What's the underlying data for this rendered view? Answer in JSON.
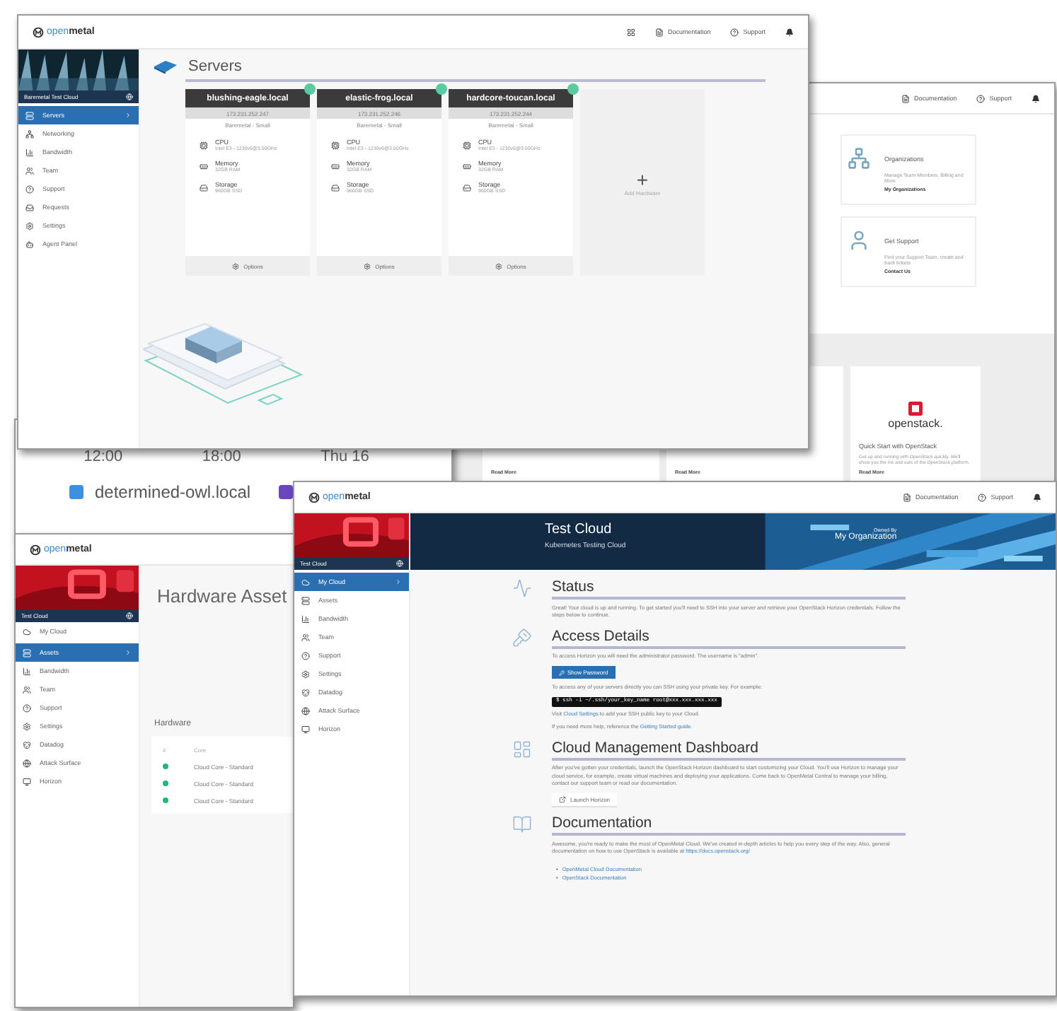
{
  "windows": [
    {
      "kind": "dashboard",
      "header": {
        "links": [
          "Documentation",
          "Support"
        ]
      },
      "cards": [
        {
          "title": "Organizations",
          "text": "Manage Team Members, Billing and More",
          "action": "My Organizations"
        },
        {
          "title": "Get Support",
          "text": "Find your Support Team, create and track tickets",
          "action": "Contact Us"
        }
      ],
      "quickstarts": [
        {
          "action": "Read More"
        },
        {
          "action": "Read More"
        },
        {
          "logo": "openstack.",
          "title": "Quick Start with OpenStack",
          "text": "Get up and running with OpenStack quickly. We'll show you the ins and outs of the OpenStack platform.",
          "action": "Read More"
        }
      ]
    },
    {
      "kind": "chart",
      "ticks": [
        "12:00",
        "18:00",
        "Thu 16"
      ],
      "legend": [
        {
          "label": "determined-owl.local",
          "color": "#3d8fe0"
        },
        {
          "color": "#6b46c1"
        }
      ]
    },
    {
      "kind": "servers",
      "logo": "open**metal**",
      "header": {
        "links": [
          "Documentation",
          "Support"
        ]
      },
      "sidebar": {
        "title": "Baremetal Test Cloud",
        "items": [
          {
            "label": "Servers",
            "selected": true
          },
          {
            "label": "Networking",
            "selected": false
          },
          {
            "label": "Bandwidth",
            "selected": false
          },
          {
            "label": "Team",
            "selected": false
          },
          {
            "label": "Support",
            "selected": false
          },
          {
            "label": "Requests",
            "selected": false
          },
          {
            "label": "Settings",
            "selected": false
          },
          {
            "label": "Agent Panel",
            "selected": false
          }
        ]
      },
      "title": "Servers",
      "servers": [
        {
          "name": "blushing-eagle.local",
          "ip": "173.231.252.247",
          "plan": "Baremetal - Small",
          "online": true,
          "specs": [
            {
              "label": "CPU",
              "value": "Intel E3 - 1230v6@3.50GHz"
            },
            {
              "label": "Memory",
              "value": "32GB RAM"
            },
            {
              "label": "Storage",
              "value": "960GB SSD"
            }
          ],
          "action": "Options"
        },
        {
          "name": "elastic-frog.local",
          "ip": "173.231.252.246",
          "plan": "Baremetal - Small",
          "online": true,
          "specs": [
            {
              "label": "CPU",
              "value": "Intel E3 - 1230v6@3.50GHz"
            },
            {
              "label": "Memory",
              "value": "32GB RAM"
            },
            {
              "label": "Storage",
              "value": "960GB SSD"
            }
          ],
          "action": "Options"
        },
        {
          "name": "hardcore-toucan.local",
          "ip": "173.231.252.244",
          "plan": "Baremetal - Small",
          "online": true,
          "specs": [
            {
              "label": "CPU",
              "value": "Intel E3 - 1230v6@3.50GHz"
            },
            {
              "label": "Memory",
              "value": "32GB RAM"
            },
            {
              "label": "Storage",
              "value": "960GB SSD"
            }
          ],
          "action": "Options"
        }
      ],
      "add": {
        "icon": "+",
        "label": "Add Hardware"
      }
    },
    {
      "kind": "assets",
      "logo": "open**metal**",
      "sidebar": {
        "title": "Test Cloud",
        "items": [
          {
            "label": "My Cloud",
            "selected": false
          },
          {
            "label": "Assets",
            "selected": true
          },
          {
            "label": "Bandwidth",
            "selected": false
          },
          {
            "label": "Team",
            "selected": false
          },
          {
            "label": "Support",
            "selected": false
          },
          {
            "label": "Settings",
            "selected": false
          },
          {
            "label": "Datadog",
            "selected": false
          },
          {
            "label": "Attack Surface",
            "selected": false
          },
          {
            "label": "Horizon",
            "selected": false
          }
        ]
      },
      "title": "Hardware Asset",
      "section": "Hardware",
      "columns": [
        "#",
        "Core"
      ],
      "rows": [
        {
          "color": "#1fb77a",
          "name": "Cloud Core - Standard"
        },
        {
          "color": "#1fb77a",
          "name": "Cloud Core - Standard"
        },
        {
          "color": "#1fb77a",
          "name": "Cloud Core - Standard"
        }
      ]
    },
    {
      "kind": "cloud",
      "logo": "open**metal**",
      "header": {
        "links": [
          "Documentation",
          "Support"
        ]
      },
      "sidebar": {
        "title": "Test Cloud",
        "items": [
          {
            "label": "My Cloud",
            "selected": true
          },
          {
            "label": "Assets",
            "selected": false
          },
          {
            "label": "Bandwidth",
            "selected": false
          },
          {
            "label": "Team",
            "selected": false
          },
          {
            "label": "Support",
            "selected": false
          },
          {
            "label": "Settings",
            "selected": false
          },
          {
            "label": "Datadog",
            "selected": false
          },
          {
            "label": "Attack Surface",
            "selected": false
          },
          {
            "label": "Horizon",
            "selected": false
          }
        ]
      },
      "banner": {
        "title": "Test Cloud",
        "subtitle": "Kubernetes Testing Cloud",
        "owner_label": "Owned By",
        "owner": "My Organization"
      },
      "sections": [
        {
          "kind": "status",
          "heading": "Status",
          "blocks": [
            {
              "kind": "text",
              "text": "Great! Your cloud is up and running. To get started you'll need to SSH into your server and retrieve your OpenStack Horizon credentials. Follow the steps below to continue."
            }
          ]
        },
        {
          "kind": "access",
          "heading": "Access Details",
          "blocks": [
            {
              "kind": "text",
              "text": "To access Horizon you will need the administrator password. The username is \"admin\"."
            },
            {
              "kind": "button",
              "text": "Show Password"
            },
            {
              "kind": "text",
              "text": "To access any of your servers directly you can SSH using your private key. For example:"
            },
            {
              "kind": "code",
              "text": "$ ssh -i ~/.ssh/your_key_name root@xxx.xxx.xxx.xxx"
            },
            {
              "kind": "linktext",
              "before": "Visit ",
              "link": "Cloud Settings",
              "after": " to add your SSH public key to your Cloud."
            },
            {
              "kind": "linktext",
              "before": "If you need more help, reference the ",
              "link": "Getting Started guide",
              "after": "."
            }
          ]
        },
        {
          "kind": "dashboard",
          "heading": "Cloud Management Dashboard",
          "blocks": [
            {
              "kind": "text",
              "text": "After you've gotten your credentials, launch the OpenStack Horizon dashboard to start customizing your Cloud. You'll use Horizon to manage your cloud service, for example, create virtual machines and deploying your applications. Come back to OpenMetal Central to manage your billing, contact our support team or read our documentation."
            },
            {
              "kind": "outline",
              "text": "Launch Horizon"
            }
          ]
        },
        {
          "kind": "docs",
          "heading": "Documentation",
          "blocks": [
            {
              "kind": "linktext",
              "before": "Awesome, you're ready to make the most of OpenMetal Cloud. We've created in-depth articles to help you every step of the way. Also, general documentation on how to use OpenStack is available at ",
              "link": "https://docs.openstack.org/"
            },
            {
              "kind": "links",
              "bullet": "•",
              "items": [
                "OpenMetal Cloud Documentation",
                "OpenStack Documentation"
              ]
            }
          ]
        }
      ]
    }
  ]
}
